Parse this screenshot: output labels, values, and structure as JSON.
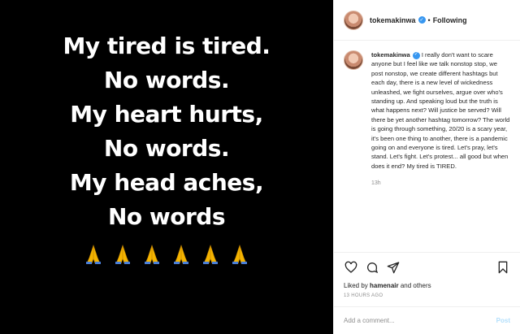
{
  "media": {
    "lines": [
      "My tired is tired.",
      "No words.",
      "My heart hurts,",
      "No words.",
      "My head aches,",
      "No words"
    ],
    "emoji": "folded-hands",
    "emoji_count": 6
  },
  "header": {
    "username": "tokemakinwa",
    "separator": "•",
    "follow_status": "Following"
  },
  "caption": {
    "username": "tokemakinwa",
    "text": "I really don't want to scare anyone but I feel like we talk nonstop stop, we post nonstop, we create different hashtags but each day, there is a new level of wickedness unleashed, we fight ourselves, argue over who's standing up. And speaking loud but the truth is what happens next? Will justice be served? Will there be yet another hashtag tomorrow? The world is going through something, 20/20 is a scary year, it's been one thing to another, there is a pandemic going on and everyone is tired. Let's pray, let's stand. Let's fight. Let's protest... all good but when does it end? My tired is TIRED.",
    "time_ago": "13h"
  },
  "actions": {
    "liked_prefix": "Liked by ",
    "liked_user": "hamenair",
    "liked_suffix": " and others",
    "timestamp": "13 HOURS AGO"
  },
  "comment": {
    "placeholder": "Add a comment...",
    "post_label": "Post"
  },
  "colors": {
    "verified": "#3897f0",
    "post_disabled": "#b2dffc",
    "muted": "#8e8e8e"
  }
}
